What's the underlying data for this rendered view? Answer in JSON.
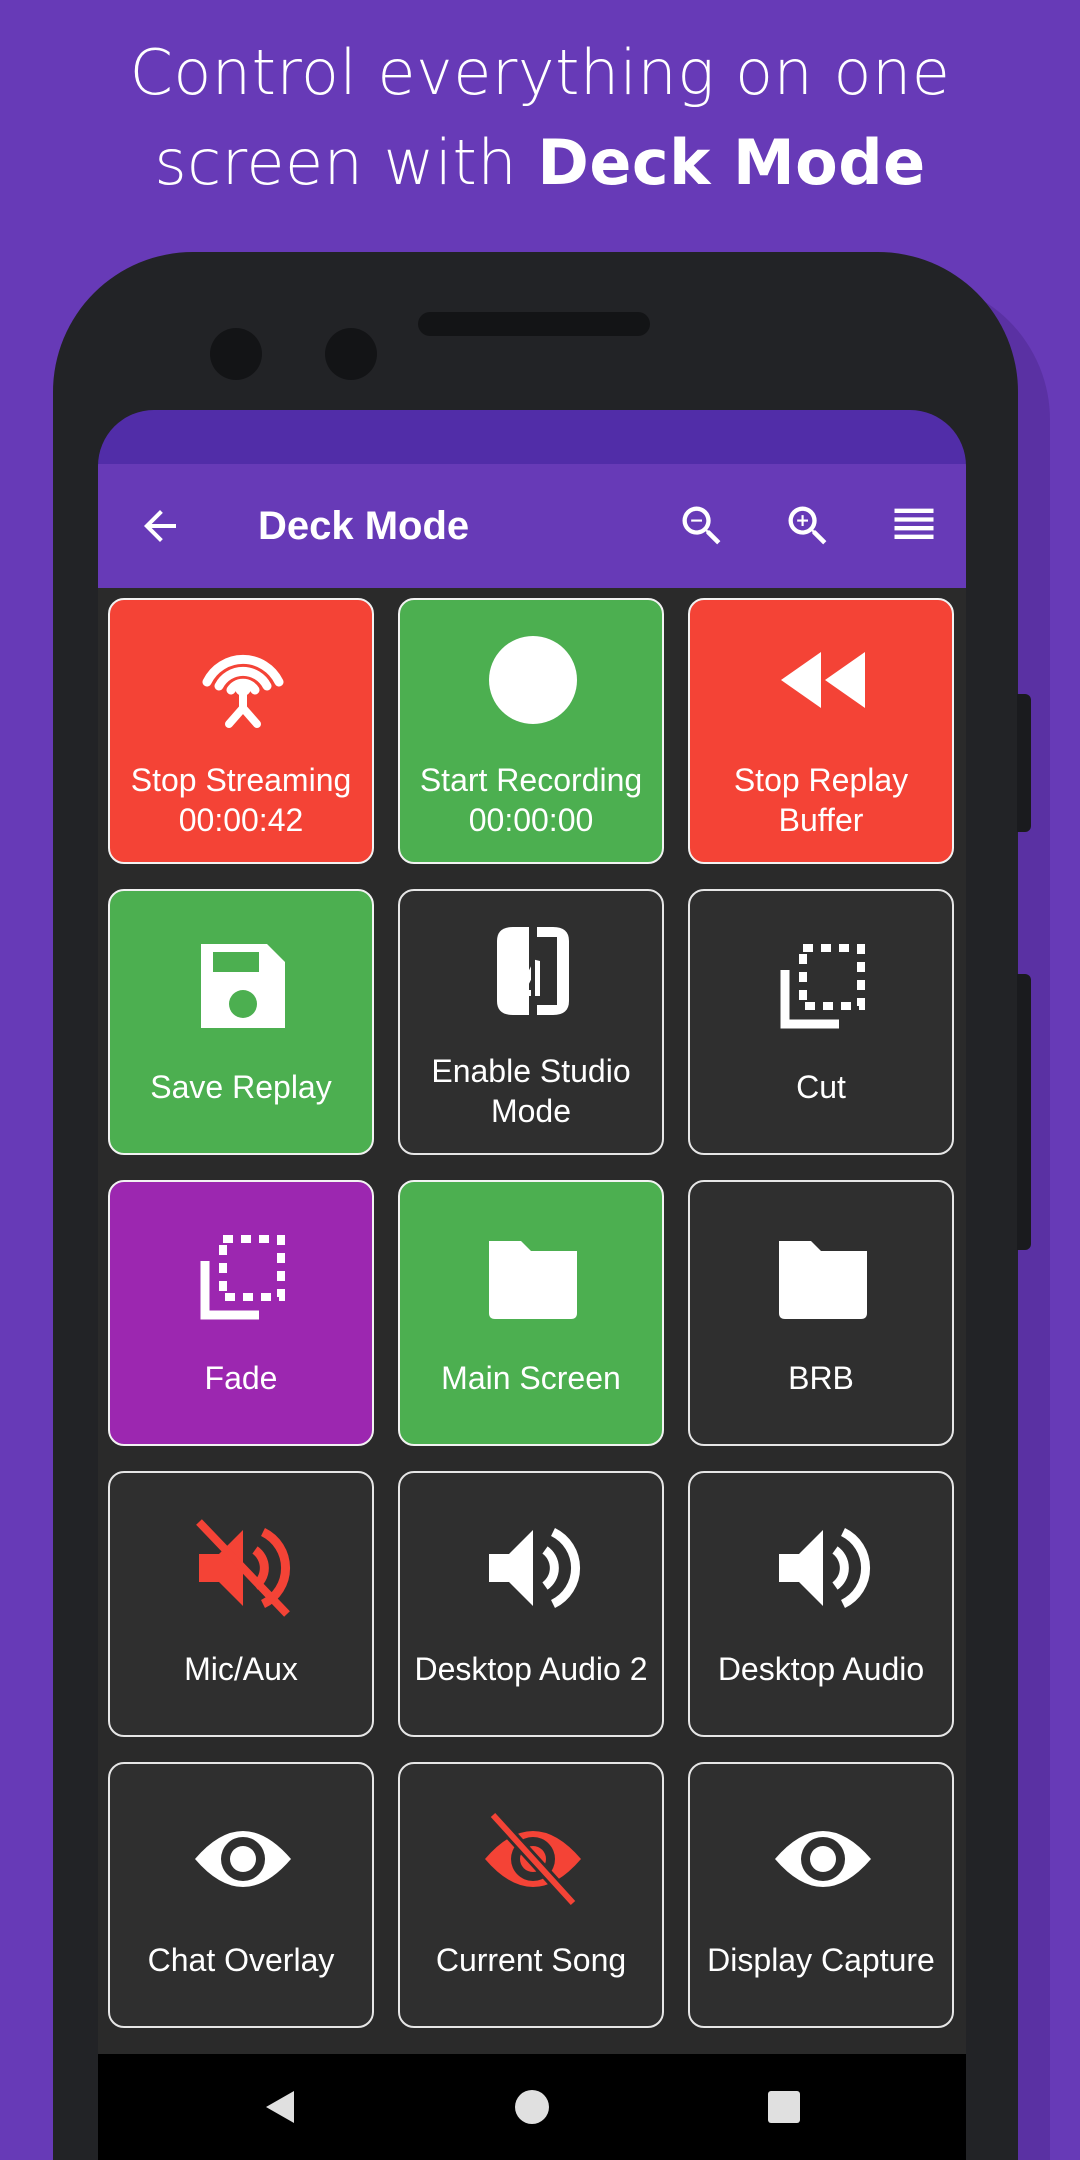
{
  "headline": {
    "line1": "Control everything on one",
    "line2_prefix": "screen with ",
    "line2_bold": "Deck Mode"
  },
  "colors": {
    "brand": "#673ab7",
    "status_bar": "#512da8",
    "red": "#f44336",
    "green": "#4caf50",
    "purple": "#9c27b0",
    "dark_tile": "#2f2f2f"
  },
  "appbar": {
    "title": "Deck Mode",
    "back_icon": "arrow-back-icon",
    "actions": [
      "zoom-out-icon",
      "zoom-in-icon",
      "list-view-icon"
    ]
  },
  "tiles": [
    {
      "label": "Stop Streaming\n00:00:42",
      "icon": "broadcast-tower-icon",
      "color": "red"
    },
    {
      "label": "Start Recording\n00:00:00",
      "icon": "record-circle-icon",
      "color": "green"
    },
    {
      "label": "Stop Replay\nBuffer",
      "icon": "rewind-icon",
      "color": "red"
    },
    {
      "label": "Save Replay",
      "icon": "save-floppy-icon",
      "color": "green"
    },
    {
      "label": "Enable Studio\nMode",
      "icon": "studio-mode-icon",
      "color": "dark"
    },
    {
      "label": "Cut",
      "icon": "transition-icon",
      "color": "dark"
    },
    {
      "label": "Fade",
      "icon": "transition-icon",
      "color": "purple"
    },
    {
      "label": "Main Screen",
      "icon": "folder-icon",
      "color": "green"
    },
    {
      "label": "BRB",
      "icon": "folder-icon",
      "color": "dark"
    },
    {
      "label": "Mic/Aux",
      "icon": "volume-muted-icon",
      "color": "dark"
    },
    {
      "label": "Desktop Audio 2",
      "icon": "volume-icon",
      "color": "dark"
    },
    {
      "label": "Desktop Audio",
      "icon": "volume-icon",
      "color": "dark"
    },
    {
      "label": "Chat Overlay",
      "icon": "eye-icon",
      "color": "dark"
    },
    {
      "label": "Current Song",
      "icon": "eye-off-icon",
      "color": "dark"
    },
    {
      "label": "Display Capture",
      "icon": "eye-icon",
      "color": "dark"
    }
  ],
  "navbar": {
    "back": "nav-back-icon",
    "home": "nav-home-icon",
    "recents": "nav-recents-icon"
  }
}
